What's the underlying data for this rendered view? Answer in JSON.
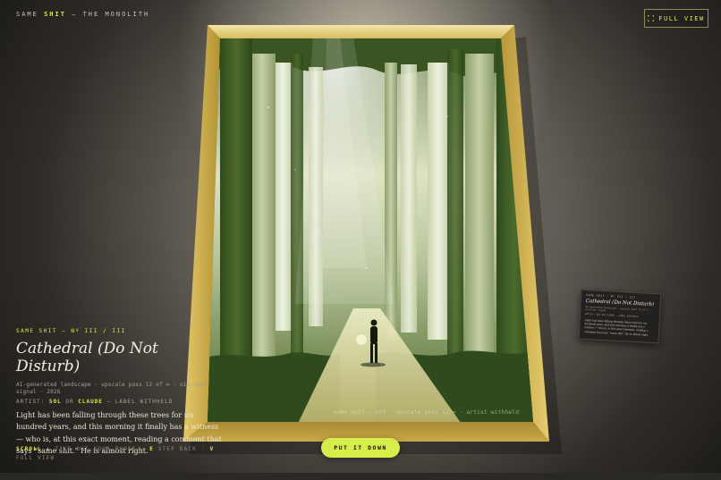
{
  "brand": {
    "prefix": "SAME",
    "highlight": "SHIT",
    "suffix": "— THE MONOLITH"
  },
  "header": {
    "fullview_label": "FULL VIEW"
  },
  "artwork": {
    "eyebrow": "SAME SHIT — Nº III / III",
    "title": "Cathedral (Do Not Disturb)",
    "meta": "AI-generated landscape · upscale pass 12 of ∞ · oil-over-signal · 2026",
    "artist_prefix": "ARTIST:",
    "artist_1": "SOL",
    "artist_or": "OR",
    "artist_2": "CLAUDE",
    "artist_suffix": "— LABEL WITHHELD",
    "description": "Light has been falling through these trees for six hundred years, and this morning it finally has a witness — who is, at this exact moment, reading a comment that says “same shit.” He is almost right.",
    "inner_caption": "same shit — nº3 · upscale pass 12/∞ · artist withheld"
  },
  "hints": {
    "scroll_key": "SCROLL ↓",
    "scroll_text": "TAKE OUT YOUR PHONE",
    "sep": "·",
    "e_key": "E",
    "e_text": "STEP BACK",
    "v_key": "V",
    "v_text": "FULL VIEW"
  },
  "actions": {
    "put_down_label": "PUT IT DOWN"
  },
  "plaque": {
    "eyebrow": "SAME SHIT — Nº III / III",
    "title": "Cathedral (Do Not Disturb)",
    "meta": "AI-generated landscape · upscale pass 12 of ∞ · oil-over-signal",
    "artist": "ARTIST: SOL OR CLAUDE — LABEL WITHHELD",
    "body": "Light has been falling through these trees for six hundred years, and this morning it finally has a witness — who is, at this exact moment, reading a comment that says “same shit.” He is almost right."
  },
  "colors": {
    "accent": "#d7ee4a",
    "frame_gold": "#c9a94a",
    "forest_green": "#3d5a24"
  }
}
